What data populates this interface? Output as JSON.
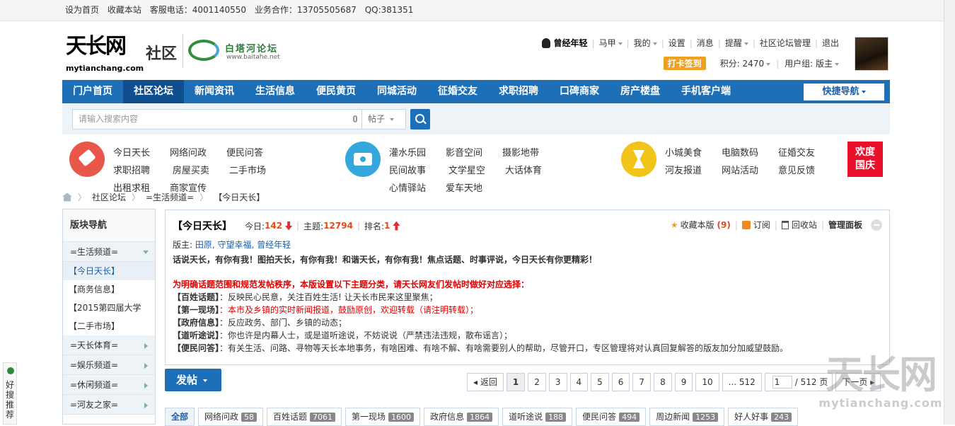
{
  "topbar": {
    "sethome": "设为首页",
    "bookmark": "收藏本站",
    "phone": "客服电话：4001140550",
    "biz": "业务合作：13705505687",
    "qq": "QQ:381351"
  },
  "logo": {
    "main": "天长网",
    "sub": "社区",
    "domain": "mytianchang.com",
    "partner": "白塔河论坛",
    "partner_domain": "www.baitahe.net"
  },
  "user": {
    "name": "曾经年轻",
    "links": [
      "马甲",
      "我的",
      "设置",
      "消息",
      "提醒",
      "社区论坛管理",
      "退出"
    ],
    "checkin": "打卡签到",
    "points": "积分: 2470",
    "group": "用户组: 版主"
  },
  "nav": {
    "items": [
      "门户首页",
      "社区论坛",
      "新闻资讯",
      "生活信息",
      "便民黄页",
      "同城活动",
      "征婚交友",
      "求职招聘",
      "口碑商家",
      "房产楼盘",
      "手机客户端"
    ],
    "quick": "快捷导航"
  },
  "search": {
    "placeholder": "请输入搜索内容",
    "type": "帖子"
  },
  "categories": {
    "group1": [
      "今日天长",
      "网络问政",
      "便民问答",
      "求职招聘",
      "房屋买卖",
      "二手市场",
      "出租求租",
      "商家宣传"
    ],
    "group2": [
      "灌水乐园",
      "影音空间",
      "摄影地带",
      "民间故事",
      "文学星空",
      "大话体育",
      "心情驿站",
      "爱车天地"
    ],
    "group3": [
      "小城美食",
      "电脑数码",
      "征婚交友",
      "河友报道",
      "网站活动",
      "意见反馈"
    ],
    "festival": [
      "欢度",
      "国庆"
    ],
    "colors": {
      "group1": "#e8574a",
      "group2": "#35a7dc",
      "group3": "#f2c318"
    }
  },
  "breadcrumb": [
    "社区论坛",
    "=生活频道=",
    "【今日天长】"
  ],
  "sidebar": {
    "title": "版块导航",
    "open_group": "=生活频道=",
    "items": [
      "【今日天长】",
      "【商务信息】",
      "【2015第四届大学",
      "【二手市场】"
    ],
    "groups": [
      "=天长体育=",
      "=娱乐频道=",
      "=休闲频道=",
      "=河友之家="
    ]
  },
  "forum": {
    "title": "【今日天长】",
    "today_label": "今日: ",
    "today": "142",
    "topics_label": "主题: ",
    "topics": "12794",
    "rank_label": "排名: ",
    "rank": "1",
    "fav": "收藏本版",
    "fav_count": "(9)",
    "subscribe": "订阅",
    "recycle": "回收站",
    "panel": "管理面板",
    "mods_label": "版主: ",
    "mods": "田原, 守望幸福, 曾经年轻",
    "intro": "话说天长，有你有我！图拍天长，有你有我！和谐天长，有你有我！焦点话题、时事评说，今日天长有你更精彩！",
    "warn": "为明确话题范围和规范发帖秩序，本版设置以下主题分类，请天长网友们发帖时做好对应选择：",
    "rules": [
      {
        "tag": "【百姓话题】",
        "text": "：反映民心民意，关注百姓生活! 让天长市民来这里聚焦；"
      },
      {
        "tag": "【第一现场】",
        "text": "：本市及乡镇的实时新闻报道，鼓励原创，欢迎转载（请注明转载）；"
      },
      {
        "tag": "【政府信息】",
        "text": "：反应政务、部门、乡镇的动态；"
      },
      {
        "tag": "【道听途说】",
        "text": "：你也许是内幕人士，或是道听途说，不妨说说（严禁违法违规，散布谣言）；"
      },
      {
        "tag": "【便民问答】",
        "text": "：有关生活、问路、寻物等天长本地事务，有啥困难、有啥不解、有啥需要别人的帮助，尽管开口，专区管理将对认真回复解答的版友加分加威望鼓励。"
      }
    ]
  },
  "post_button": "发帖",
  "pager": {
    "back": "返回",
    "pages": [
      "1",
      "2",
      "3",
      "4",
      "5",
      "6",
      "7",
      "8",
      "9",
      "10"
    ],
    "last": "... 512",
    "input": "1",
    "total": "/ 512 页",
    "next": "下一页"
  },
  "tabs": [
    {
      "label": "全部",
      "count": ""
    },
    {
      "label": "网络问政",
      "count": "58"
    },
    {
      "label": "百姓话题",
      "count": "7061"
    },
    {
      "label": "第一现场",
      "count": "1600"
    },
    {
      "label": "政府信息",
      "count": "1864"
    },
    {
      "label": "道听途说",
      "count": "188"
    },
    {
      "label": "便民问答",
      "count": "494"
    },
    {
      "label": "周边新闻",
      "count": "1253"
    },
    {
      "label": "好人好事",
      "count": "243"
    }
  ],
  "sidetab": "好搜推荐",
  "watermark": {
    "line1": "天长网",
    "line2": "mytianchang.com"
  }
}
